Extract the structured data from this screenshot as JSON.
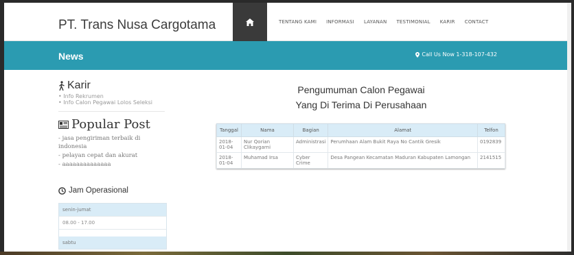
{
  "header": {
    "brand": "PT. Trans Nusa Cargotama",
    "home_icon": "home-icon",
    "nav": [
      "TENTANG KAMI",
      "INFORMASI",
      "LAYANAN",
      "TESTIMONIAL",
      "KARIR",
      "CONTACT"
    ]
  },
  "banner": {
    "title": "News",
    "call": "Call Us Now 1-318-107-432",
    "color": "#2b9bb1"
  },
  "sidebar": {
    "karir_title": "Karir",
    "karir_items": [
      "Info Rekrumen",
      "Info Calon Pegawai Lolos Seleksi"
    ],
    "popular_title": "Popular Post",
    "popular_items": [
      "jasa pengiriman terbaik di indonesia",
      "pelayan cepat dan akurat",
      "aaaaaaaaaaaaaa"
    ],
    "jam_title": "Jam Operasional",
    "jam": [
      {
        "label": "senin-jumat",
        "value": "08.00 - 17.00"
      },
      {
        "label": "sabtu",
        "value": ""
      }
    ]
  },
  "main": {
    "title_line1": "Pengumuman Calon Pegawai",
    "title_line2": "Yang Di Terima Di Perusahaan",
    "table": {
      "headers": [
        "Tanggal",
        "Nama",
        "Bagian",
        "Alamat",
        "Telfon"
      ],
      "rows": [
        [
          "2018-01-04",
          "Nur Qorian Clikaygarni",
          "Administrasi",
          "Perumhaan Alam Bukit Raya No Cantik Gresik",
          "0192839"
        ],
        [
          "2018-01-04",
          "Muhamad Irsa",
          "Cyber Crime",
          "Desa Pangean Kecamatan Maduran Kabupaten Lamongan",
          "2141515"
        ]
      ]
    }
  }
}
